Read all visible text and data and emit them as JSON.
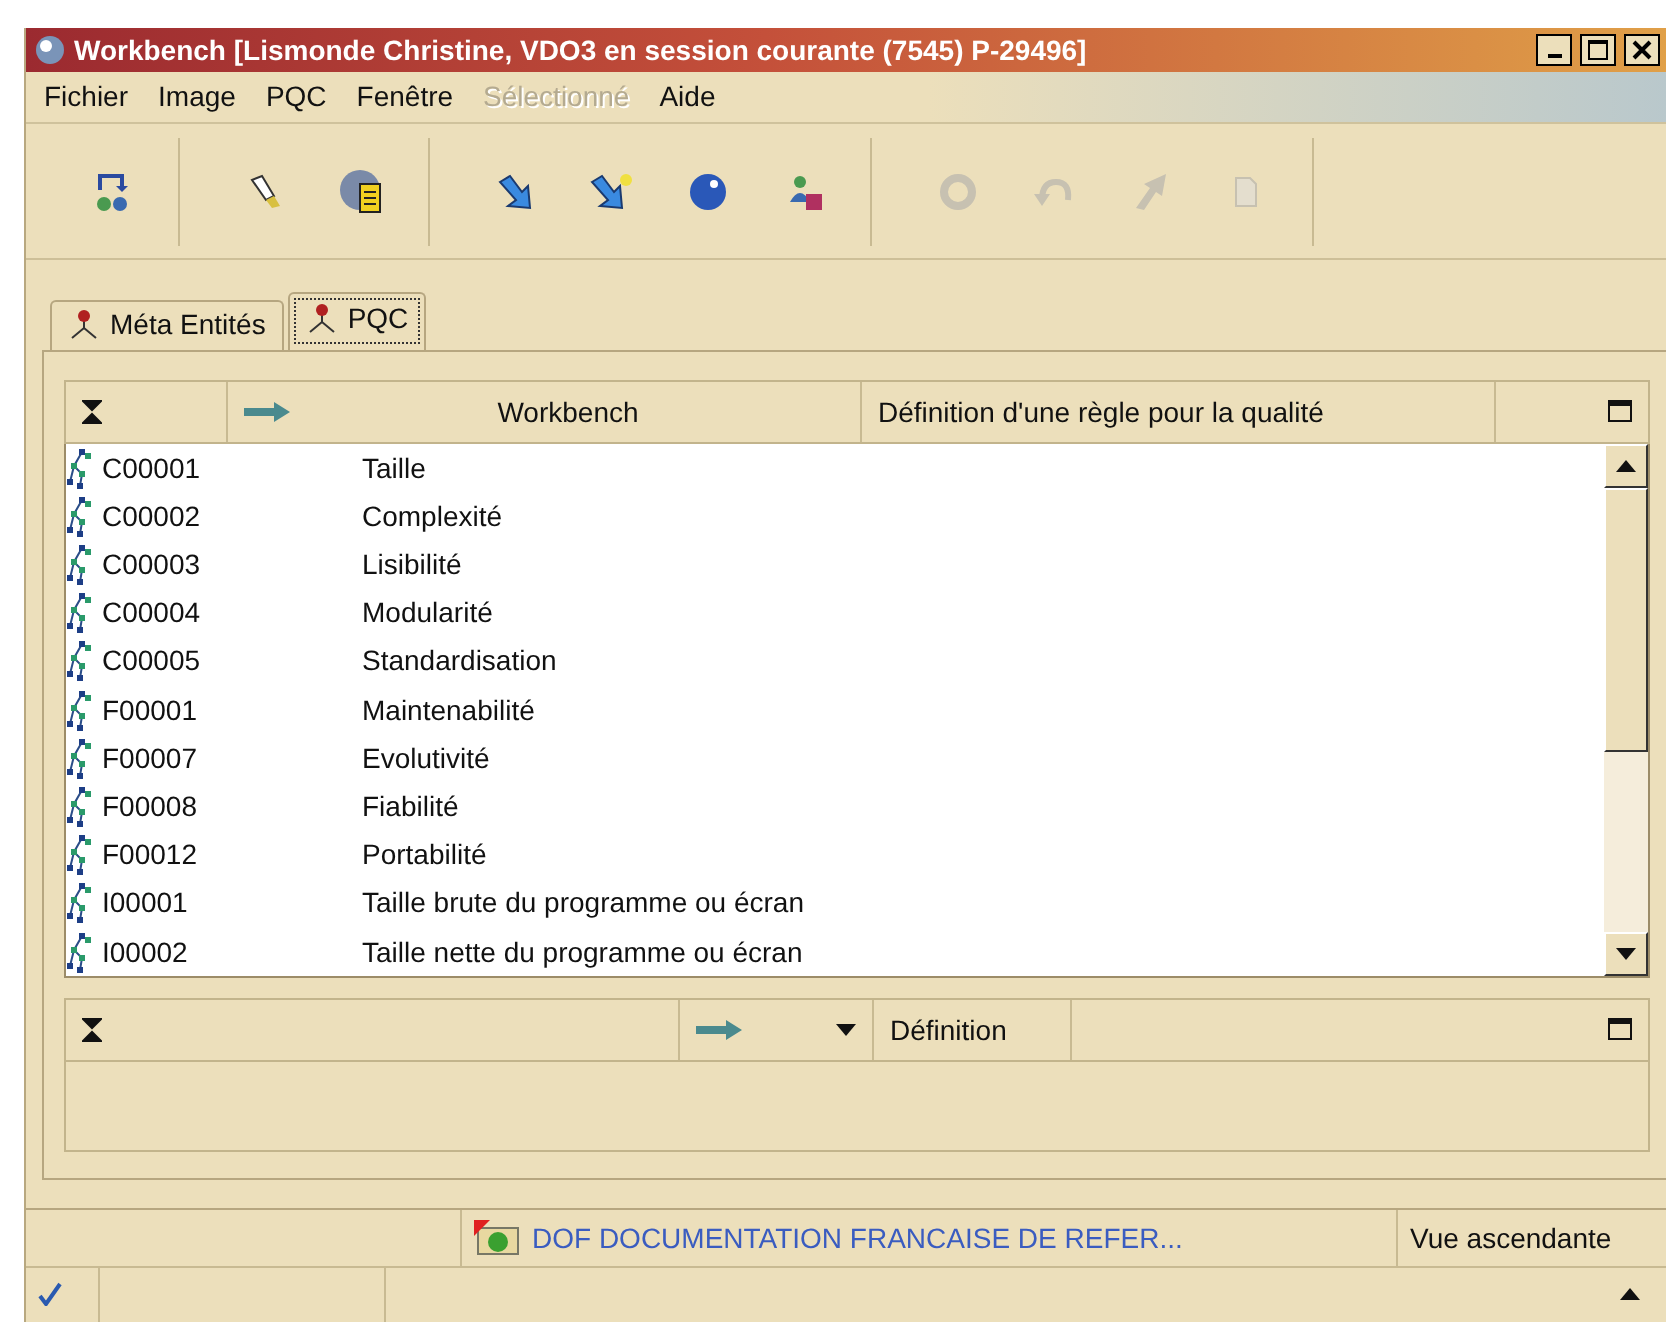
{
  "window": {
    "title": "Workbench [Lismonde Christine, VDO3 en session courante (7545) P-29496]"
  },
  "menu": [
    {
      "label": "Fichier",
      "disabled": false
    },
    {
      "label": "Image",
      "disabled": false
    },
    {
      "label": "PQC",
      "disabled": false
    },
    {
      "label": "Fenêtre",
      "disabled": false
    },
    {
      "label": "Sélectionné",
      "disabled": true
    },
    {
      "label": "Aide",
      "disabled": false
    }
  ],
  "toolbar": [
    {
      "buttons": [
        {
          "kind": "swap",
          "disabled": false
        }
      ]
    },
    {
      "buttons": [
        {
          "kind": "flashlight",
          "disabled": false
        },
        {
          "kind": "document",
          "disabled": false
        }
      ]
    },
    {
      "buttons": [
        {
          "kind": "arrow",
          "disabled": false
        },
        {
          "kind": "arrowstar",
          "disabled": false
        },
        {
          "kind": "globe",
          "disabled": false
        },
        {
          "kind": "person",
          "disabled": false
        }
      ]
    },
    {
      "buttons": [
        {
          "kind": "refresh",
          "disabled": true
        },
        {
          "kind": "undo",
          "disabled": true
        },
        {
          "kind": "arrowup",
          "disabled": true
        },
        {
          "kind": "page",
          "disabled": true
        }
      ]
    }
  ],
  "tabs": [
    {
      "label": "Méta Entités",
      "selected": false
    },
    {
      "label": "PQC",
      "selected": true
    }
  ],
  "table": {
    "columns": [
      "Workbench",
      "Définition d'une règle pour la qualité"
    ],
    "rows": [
      {
        "code": "C00001",
        "name": "Taille"
      },
      {
        "code": "C00002",
        "name": "Complexité"
      },
      {
        "code": "C00003",
        "name": "Lisibilité"
      },
      {
        "code": "C00004",
        "name": "Modularité"
      },
      {
        "code": "C00005",
        "name": "Standardisation"
      },
      {
        "code": "F00001",
        "name": "Maintenabilité"
      },
      {
        "code": "F00007",
        "name": "Evolutivité"
      },
      {
        "code": "F00008",
        "name": "Fiabilité"
      },
      {
        "code": "F00012",
        "name": "Portabilité"
      },
      {
        "code": "I00001",
        "name": "Taille brute du programme ou écran"
      },
      {
        "code": "I00002",
        "name": "Taille nette du programme ou écran"
      }
    ]
  },
  "detail": {
    "columns": [
      "Définition"
    ]
  },
  "status_bar": {
    "document": "DOF DOCUMENTATION FRANCAISE DE REFER...",
    "view": "Vue ascendante"
  }
}
